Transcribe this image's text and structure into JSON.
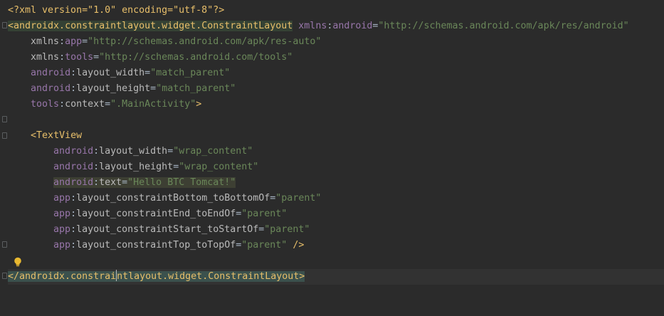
{
  "editor": {
    "language": "xml",
    "lines": [
      {
        "kind": "pi",
        "text": "<?xml version=\"1.0\" encoding=\"utf-8\"?>"
      },
      {
        "kind": "open-root",
        "tag": "androidx.constraintlayout.widget.ConstraintLayout",
        "attr_ns": "xmlns",
        "attr_name": "android",
        "attr_value": "\"http://schemas.android.com/apk/res/android\""
      },
      {
        "kind": "attr",
        "indent": 1,
        "ns": "xmlns",
        "name": "app",
        "value": "\"http://schemas.android.com/apk/res-auto\""
      },
      {
        "kind": "attr",
        "indent": 1,
        "ns": "xmlns",
        "name": "tools",
        "value": "\"http://schemas.android.com/tools\""
      },
      {
        "kind": "attr",
        "indent": 1,
        "ns": "android",
        "name": "layout_width",
        "value": "\"match_parent\""
      },
      {
        "kind": "attr",
        "indent": 1,
        "ns": "android",
        "name": "layout_height",
        "value": "\"match_parent\""
      },
      {
        "kind": "attr-close",
        "indent": 1,
        "ns": "tools",
        "name": "context",
        "value": "\".MainActivity\"",
        "close": ">"
      },
      {
        "kind": "blank"
      },
      {
        "kind": "open",
        "indent": 1,
        "tag": "TextView"
      },
      {
        "kind": "attr",
        "indent": 2,
        "ns": "android",
        "name": "layout_width",
        "value": "\"wrap_content\""
      },
      {
        "kind": "attr",
        "indent": 2,
        "ns": "android",
        "name": "layout_height",
        "value": "\"wrap_content\""
      },
      {
        "kind": "attr",
        "indent": 2,
        "ns": "android",
        "name": "text",
        "value": "\"Hello BTC Tomcat!\"",
        "highlight": true
      },
      {
        "kind": "attr",
        "indent": 2,
        "ns": "app",
        "name": "layout_constraintBottom_toBottomOf",
        "value": "\"parent\""
      },
      {
        "kind": "attr",
        "indent": 2,
        "ns": "app",
        "name": "layout_constraintEnd_toEndOf",
        "value": "\"parent\""
      },
      {
        "kind": "attr",
        "indent": 2,
        "ns": "app",
        "name": "layout_constraintStart_toStartOf",
        "value": "\"parent\""
      },
      {
        "kind": "attr-close",
        "indent": 2,
        "ns": "app",
        "name": "layout_constraintTop_toTopOf",
        "value": "\"parent\"",
        "close": " />"
      },
      {
        "kind": "blank"
      },
      {
        "kind": "close-root",
        "tag_before_caret": "androidx.constrai",
        "tag_after_caret": "ntlayout.widget.ConstraintLayout"
      }
    ]
  },
  "colors": {
    "background": "#2b2b2b",
    "tag": "#e8bf6a",
    "namespace": "#9876aa",
    "attribute": "#bababa",
    "string": "#6a8759"
  },
  "icons": {
    "intention": "lightbulb-icon",
    "fold": "fold-marker-icon"
  }
}
